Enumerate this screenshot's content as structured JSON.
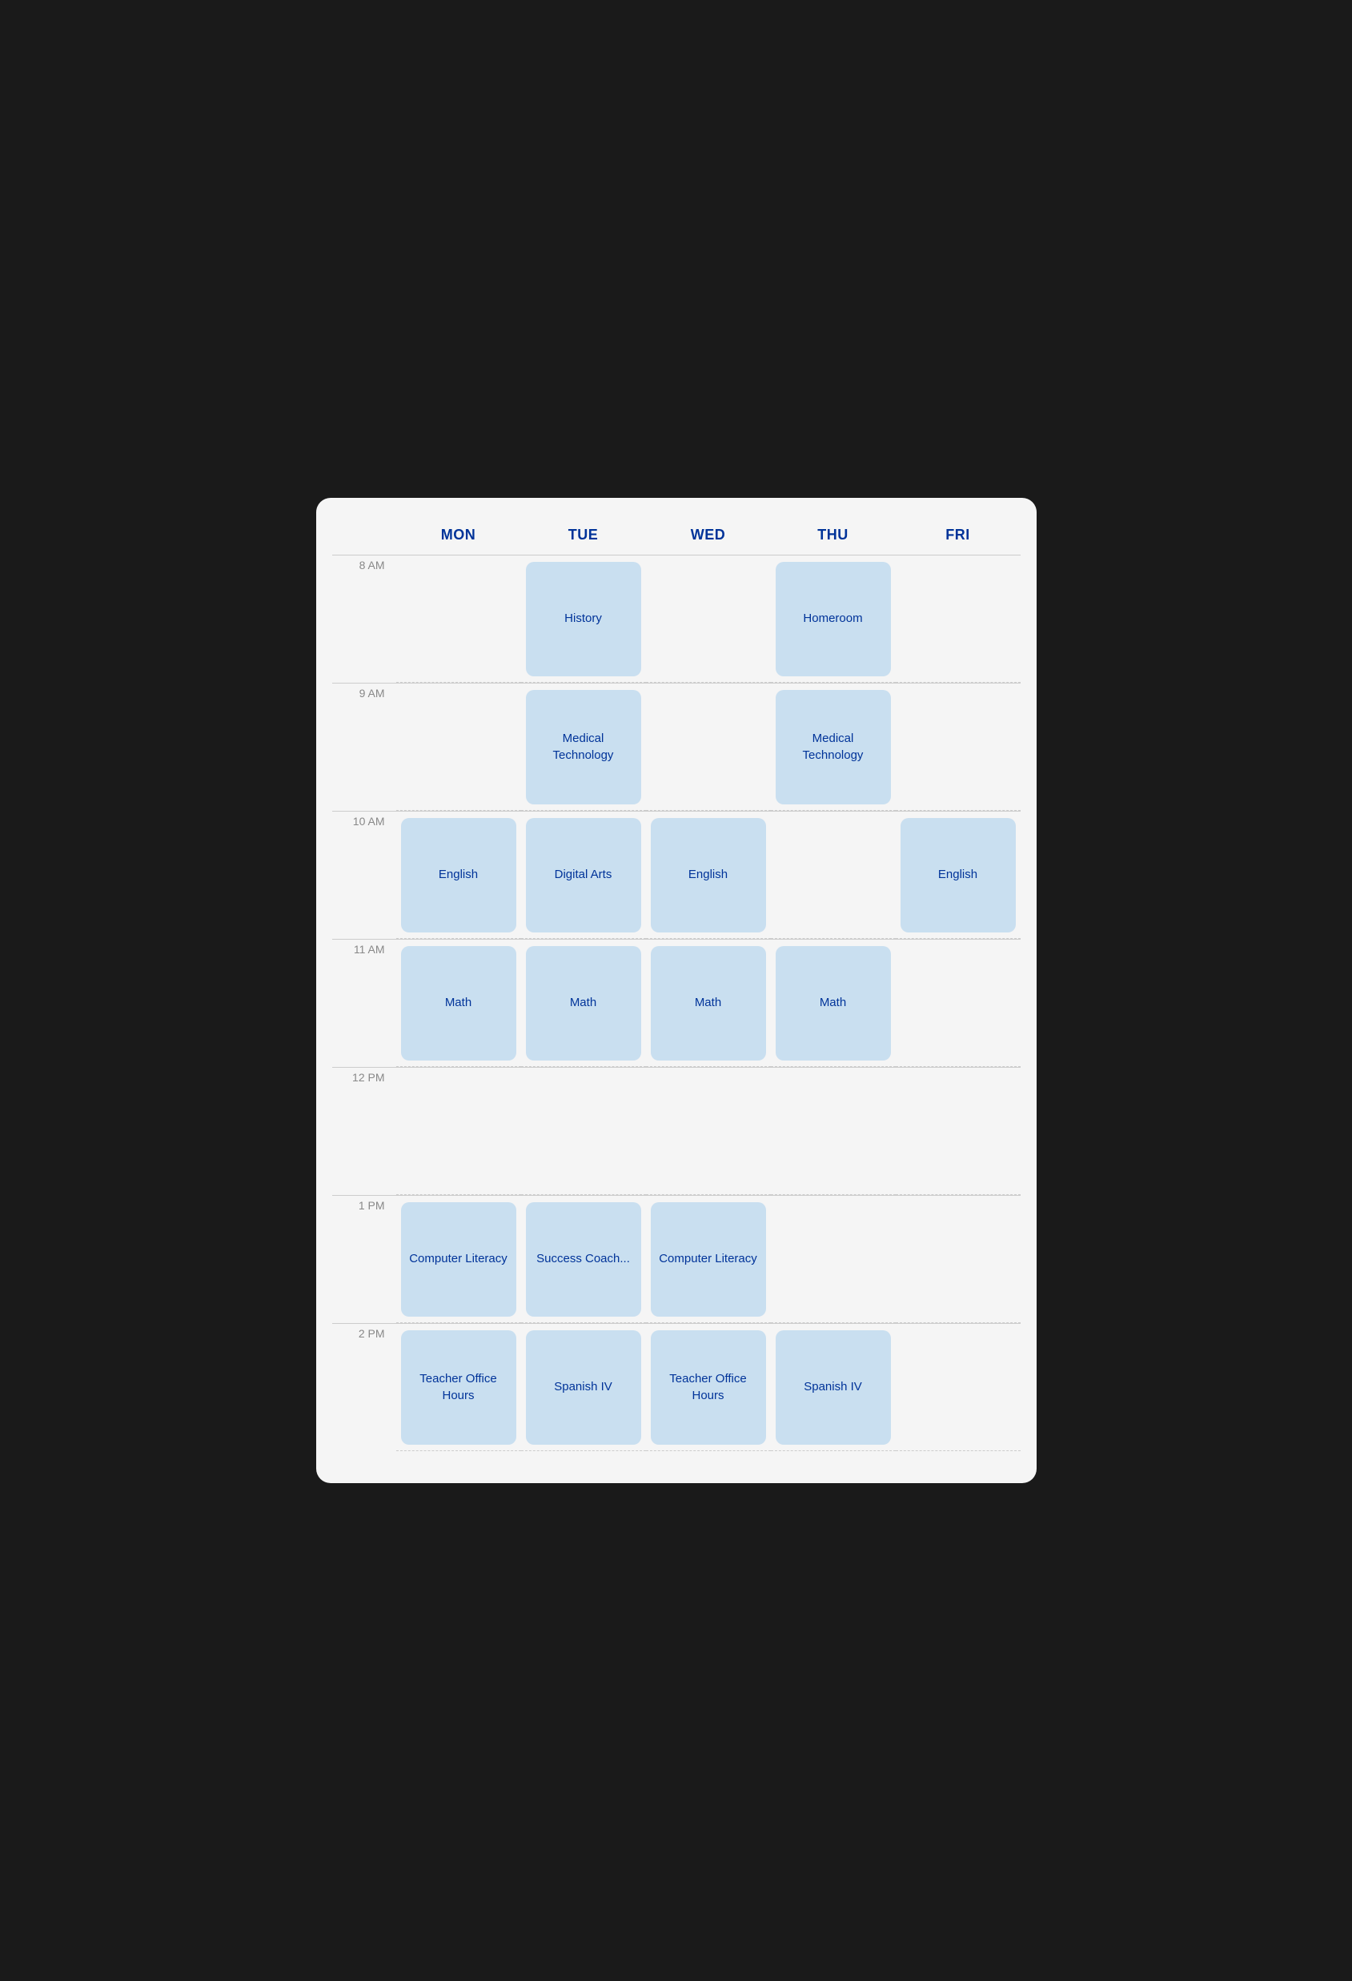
{
  "header": {
    "days": [
      "MON",
      "TUE",
      "WED",
      "THU",
      "FRI"
    ]
  },
  "timeSlots": [
    {
      "label": "8 AM",
      "cells": [
        {
          "text": null
        },
        {
          "text": "History"
        },
        {
          "text": null
        },
        {
          "text": "Homeroom"
        },
        {
          "text": null
        }
      ]
    },
    {
      "label": "9 AM",
      "cells": [
        {
          "text": null
        },
        {
          "text": "Medical Technology"
        },
        {
          "text": null
        },
        {
          "text": "Medical Technology"
        },
        {
          "text": null
        }
      ]
    },
    {
      "label": "10 AM",
      "cells": [
        {
          "text": "English"
        },
        {
          "text": "Digital Arts"
        },
        {
          "text": "English"
        },
        {
          "text": null
        },
        {
          "text": "English"
        }
      ]
    },
    {
      "label": "11 AM",
      "cells": [
        {
          "text": "Math"
        },
        {
          "text": "Math"
        },
        {
          "text": "Math"
        },
        {
          "text": "Math"
        },
        {
          "text": null
        }
      ]
    },
    {
      "label": "12 PM",
      "cells": [
        {
          "text": null
        },
        {
          "text": null
        },
        {
          "text": null
        },
        {
          "text": null
        },
        {
          "text": null
        }
      ]
    },
    {
      "label": "1 PM",
      "cells": [
        {
          "text": "Computer Literacy"
        },
        {
          "text": "Success Coach..."
        },
        {
          "text": "Computer Literacy"
        },
        {
          "text": null
        },
        {
          "text": null
        }
      ]
    },
    {
      "label": "2 PM",
      "cells": [
        {
          "text": "Teacher Office Hours"
        },
        {
          "text": "Spanish IV"
        },
        {
          "text": "Teacher Office Hours"
        },
        {
          "text": "Spanish IV"
        },
        {
          "text": null
        }
      ]
    }
  ]
}
